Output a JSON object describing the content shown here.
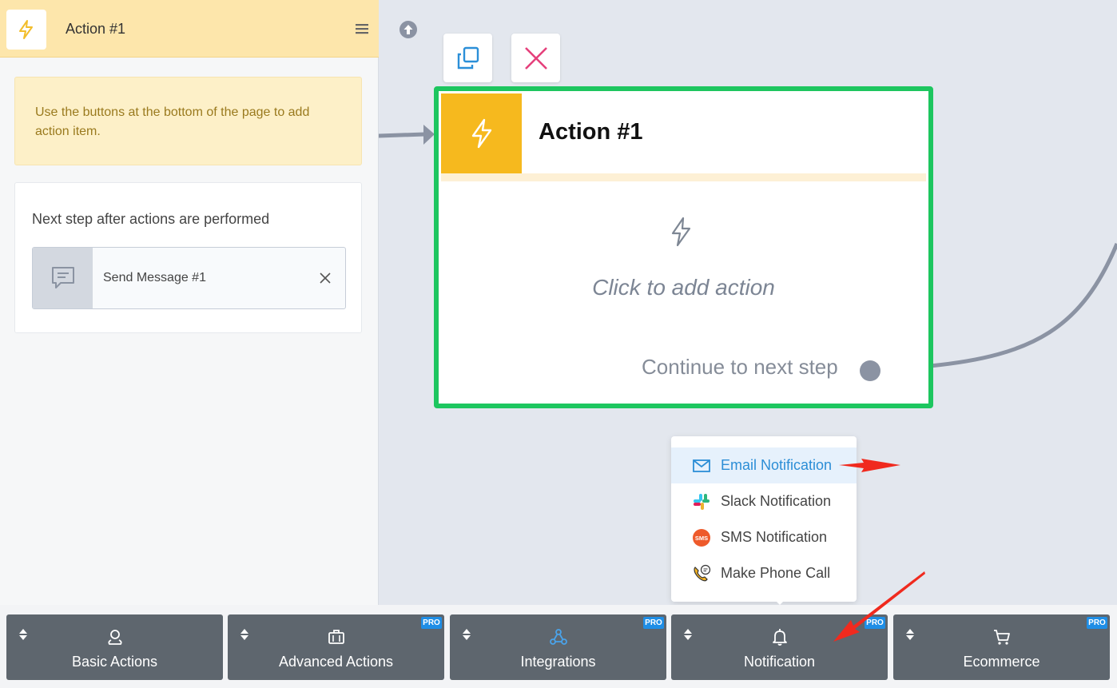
{
  "sidebar": {
    "title": "Action #1",
    "notice": "Use the buttons at the bottom of the page to add action item.",
    "next_step_title": "Next step after actions are performed",
    "next_step_item": "Send Message #1"
  },
  "node": {
    "title": "Action #1",
    "add_action": "Click to add action",
    "continue": "Continue to next step"
  },
  "notification_menu": {
    "items": [
      {
        "label": "Email Notification",
        "icon": "mail-icon",
        "active": true
      },
      {
        "label": "Slack Notification",
        "icon": "slack-icon",
        "active": false
      },
      {
        "label": "SMS Notification",
        "icon": "sms-icon",
        "active": false
      },
      {
        "label": "Make Phone Call",
        "icon": "phone-call-icon",
        "active": false
      }
    ]
  },
  "toolbar": {
    "buttons": [
      {
        "label": "Basic Actions",
        "icon": "location-pin-icon",
        "pro": false
      },
      {
        "label": "Advanced Actions",
        "icon": "briefcase-icon",
        "pro": true
      },
      {
        "label": "Integrations",
        "icon": "webhook-icon",
        "pro": true
      },
      {
        "label": "Notification",
        "icon": "bell-icon",
        "pro": true
      },
      {
        "label": "Ecommerce",
        "icon": "cart-icon",
        "pro": true
      }
    ],
    "pro_label": "PRO"
  },
  "colors": {
    "node_border": "#1dc65f",
    "action_accent": "#f6b91e",
    "toolbar_button": "#5e666e",
    "pro_badge": "#1f8ee6",
    "annotation_arrow": "#f02a1e"
  }
}
